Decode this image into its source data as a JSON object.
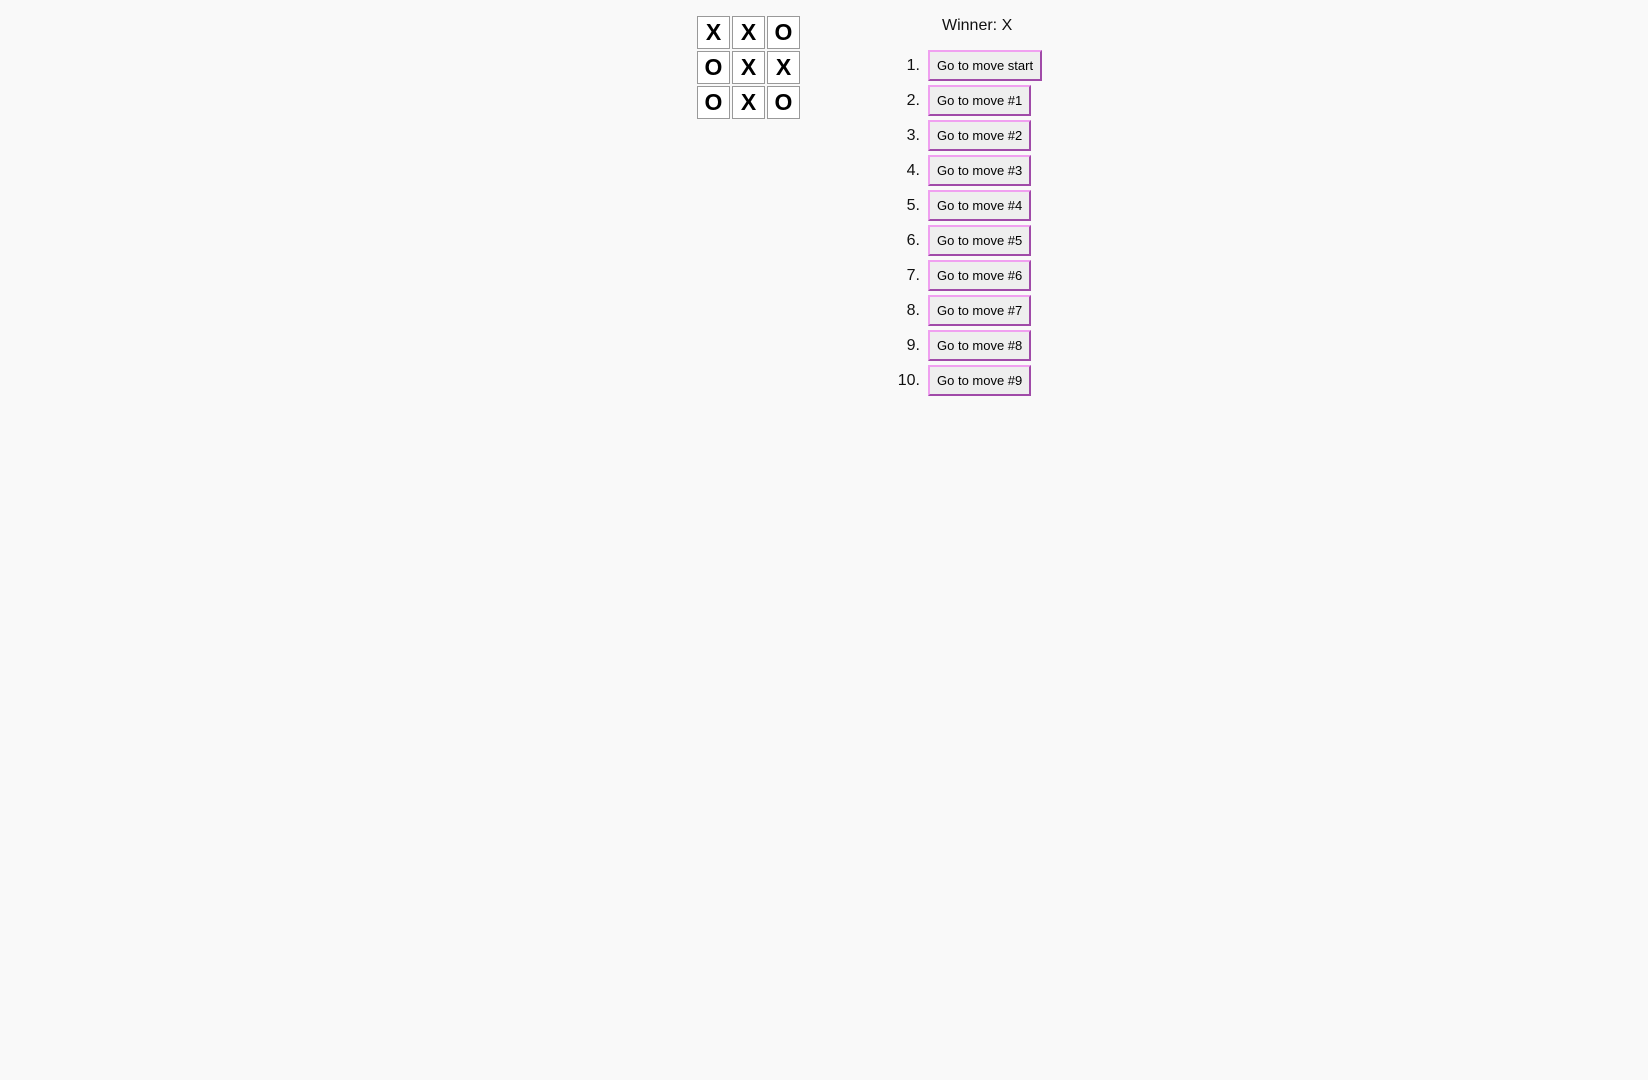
{
  "board": {
    "squares": [
      "X",
      "X",
      "O",
      "O",
      "X",
      "X",
      "O",
      "X",
      "O"
    ]
  },
  "status": "Winner: X",
  "moves": [
    {
      "number": "1.",
      "label": "Go to move start"
    },
    {
      "number": "2.",
      "label": "Go to move #1"
    },
    {
      "number": "3.",
      "label": "Go to move #2"
    },
    {
      "number": "4.",
      "label": "Go to move #3"
    },
    {
      "number": "5.",
      "label": "Go to move #4"
    },
    {
      "number": "6.",
      "label": "Go to move #5"
    },
    {
      "number": "7.",
      "label": "Go to move #6"
    },
    {
      "number": "8.",
      "label": "Go to move #7"
    },
    {
      "number": "9.",
      "label": "Go to move #8"
    },
    {
      "number": "10.",
      "label": "Go to move #9"
    }
  ],
  "colors": {
    "background": "#f9f9f9",
    "button_border_light": "#f0a0f0",
    "button_border_dark": "#a04aa8",
    "button_fill": "#eeeeee"
  }
}
